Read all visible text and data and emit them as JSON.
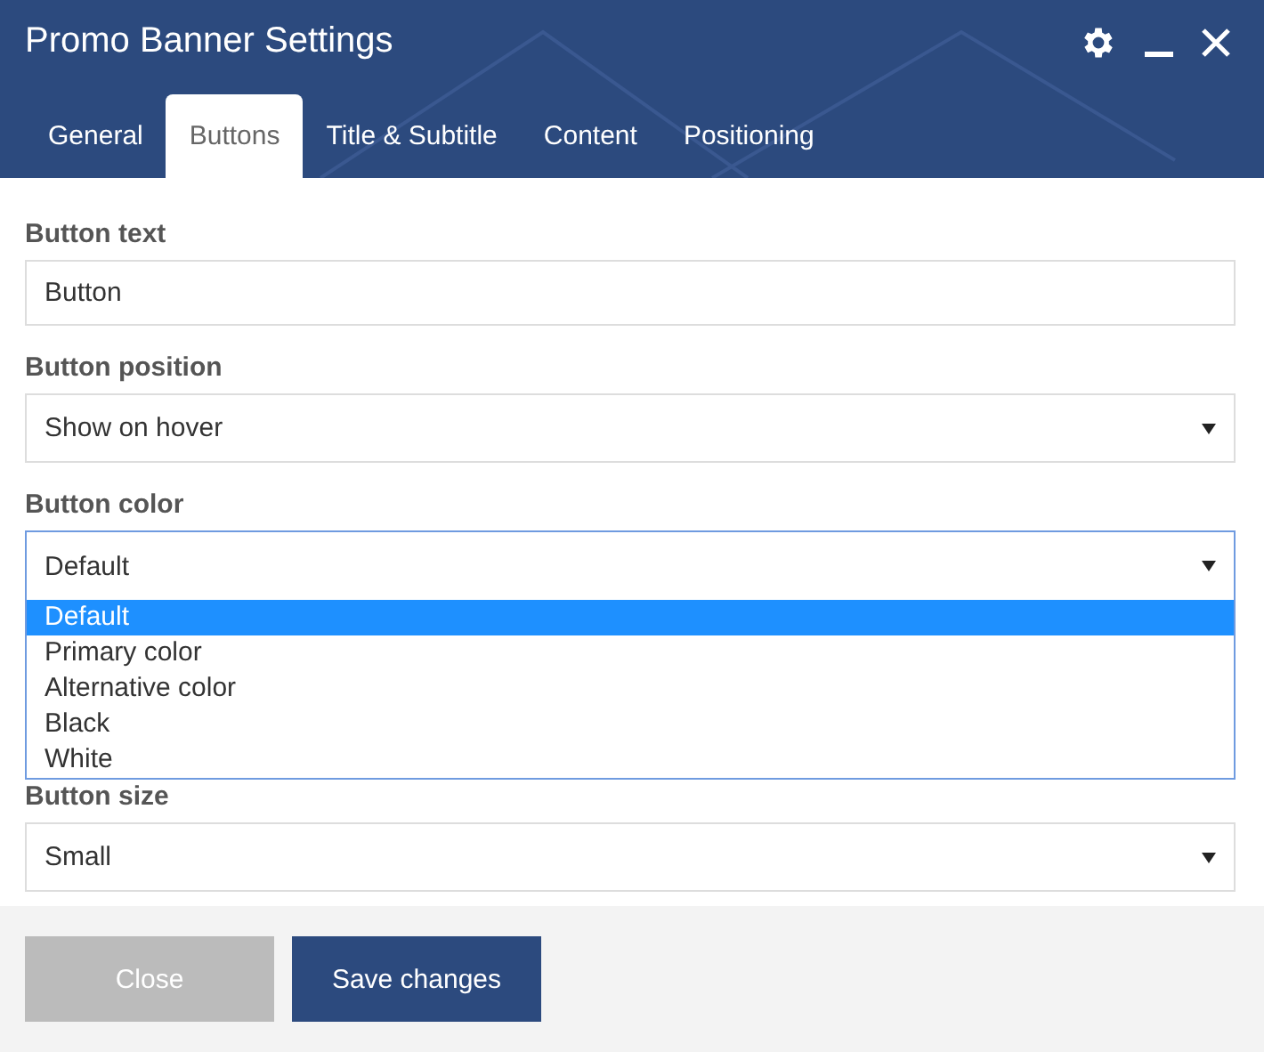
{
  "window": {
    "title": "Promo Banner Settings"
  },
  "tabs": [
    {
      "label": "General",
      "selected": false
    },
    {
      "label": "Buttons",
      "selected": true
    },
    {
      "label": "Title & Subtitle",
      "selected": false
    },
    {
      "label": "Content",
      "selected": false
    },
    {
      "label": "Positioning",
      "selected": false
    }
  ],
  "fields": [
    {
      "kind": "text",
      "label": "Button text",
      "value": "Button"
    },
    {
      "kind": "select",
      "label": "Button position",
      "value": "Show on hover",
      "open": false
    },
    {
      "kind": "select",
      "label": "Button color",
      "value": "Default",
      "open": true,
      "options": [
        {
          "label": "Default",
          "selected": true
        },
        {
          "label": "Primary color",
          "selected": false
        },
        {
          "label": "Alternative color",
          "selected": false
        },
        {
          "label": "Black",
          "selected": false
        },
        {
          "label": "White",
          "selected": false
        }
      ]
    },
    {
      "kind": "select",
      "label": "Button size",
      "value": "Small",
      "open": false
    }
  ],
  "buttons": [
    {
      "label": "Close",
      "kind": "secondary"
    },
    {
      "label": "Save changes",
      "kind": "primary"
    }
  ]
}
